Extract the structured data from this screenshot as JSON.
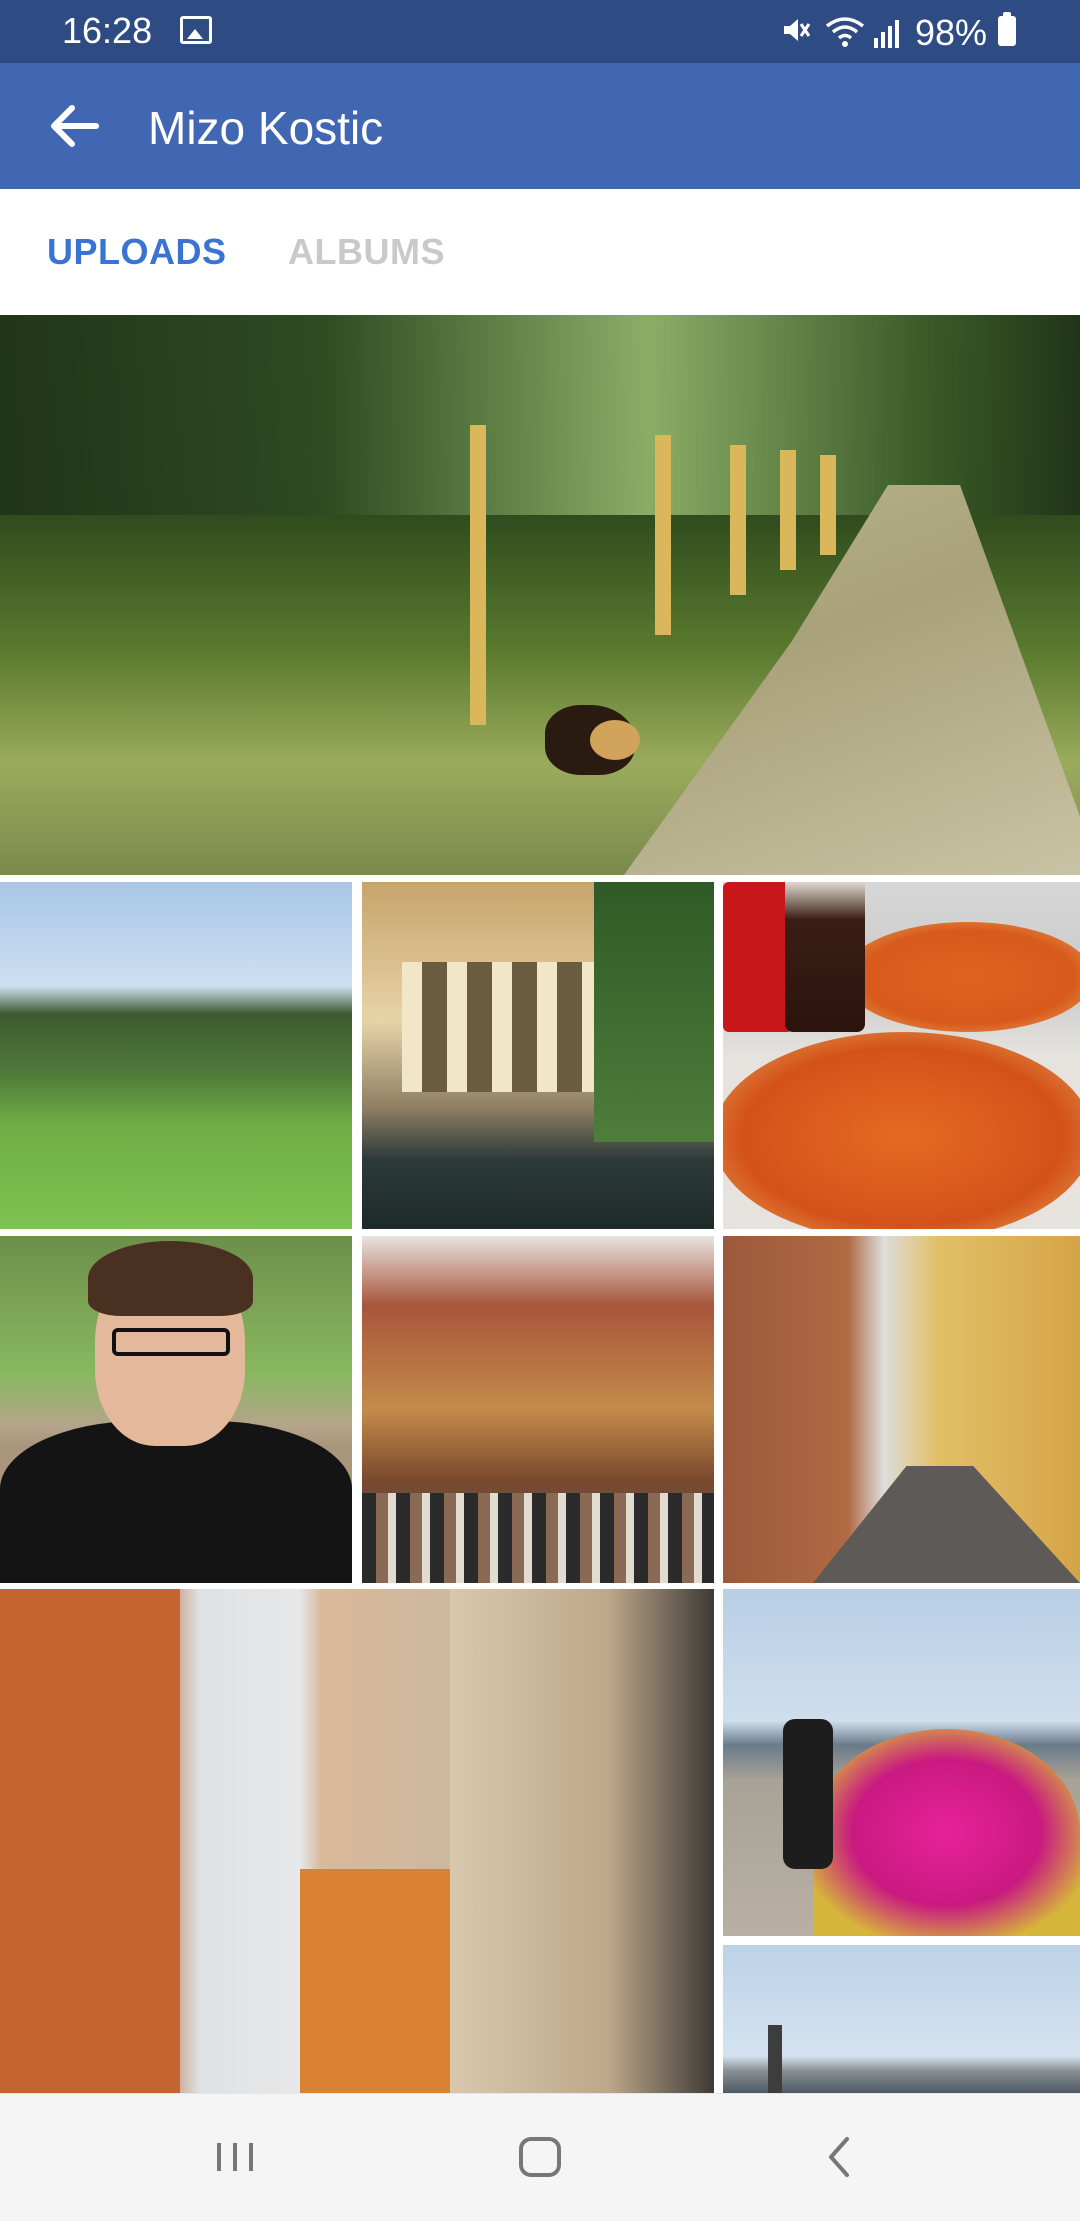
{
  "status_bar": {
    "time": "16:28",
    "battery": "98%"
  },
  "app_bar": {
    "title": "Mizo Kostic"
  },
  "tabs": [
    {
      "label": "UPLOADS",
      "active": true
    },
    {
      "label": "ALBUMS",
      "active": false
    }
  ],
  "colors": {
    "status_bar": "#2f4b84",
    "app_bar": "#4267b2",
    "active_tab": "#3b73d3",
    "inactive_tab": "#c9c9c9"
  },
  "icons": {
    "back": "back-arrow-icon",
    "nav_recents": "recents-icon",
    "nav_home": "home-icon",
    "nav_back": "chevron-left-icon"
  }
}
